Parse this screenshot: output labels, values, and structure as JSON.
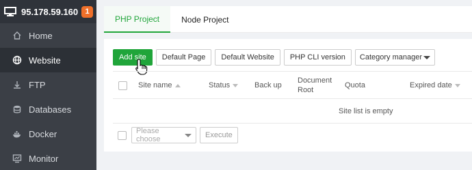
{
  "sidebar": {
    "ip": "95.178.59.160",
    "badge": "1",
    "items": [
      {
        "label": "Home",
        "icon": "home-icon"
      },
      {
        "label": "Website",
        "icon": "globe-icon",
        "active": true
      },
      {
        "label": "FTP",
        "icon": "ftp-icon"
      },
      {
        "label": "Databases",
        "icon": "database-icon"
      },
      {
        "label": "Docker",
        "icon": "docker-icon"
      },
      {
        "label": "Monitor",
        "icon": "monitor-chart-icon"
      }
    ]
  },
  "tabs": [
    {
      "label": "PHP Project",
      "active": true
    },
    {
      "label": "Node Project",
      "active": false
    }
  ],
  "toolbar": {
    "add_site": "Add site",
    "default_page": "Default Page",
    "default_website": "Default Website",
    "php_cli": "PHP CLI version",
    "category_manager": "Category manager"
  },
  "table": {
    "headers": {
      "site_name": "Site name",
      "status": "Status",
      "backup": "Back up",
      "doc_root_1": "Document",
      "doc_root_2": "Root",
      "quota": "Quota",
      "expired": "Expired date"
    },
    "empty_text": "Site list is empty"
  },
  "footer": {
    "choose_placeholder": "Please choose",
    "execute": "Execute"
  },
  "colors": {
    "accent": "#20a53a",
    "sidebar_bg": "#3b3f46",
    "badge": "#f0702a"
  }
}
